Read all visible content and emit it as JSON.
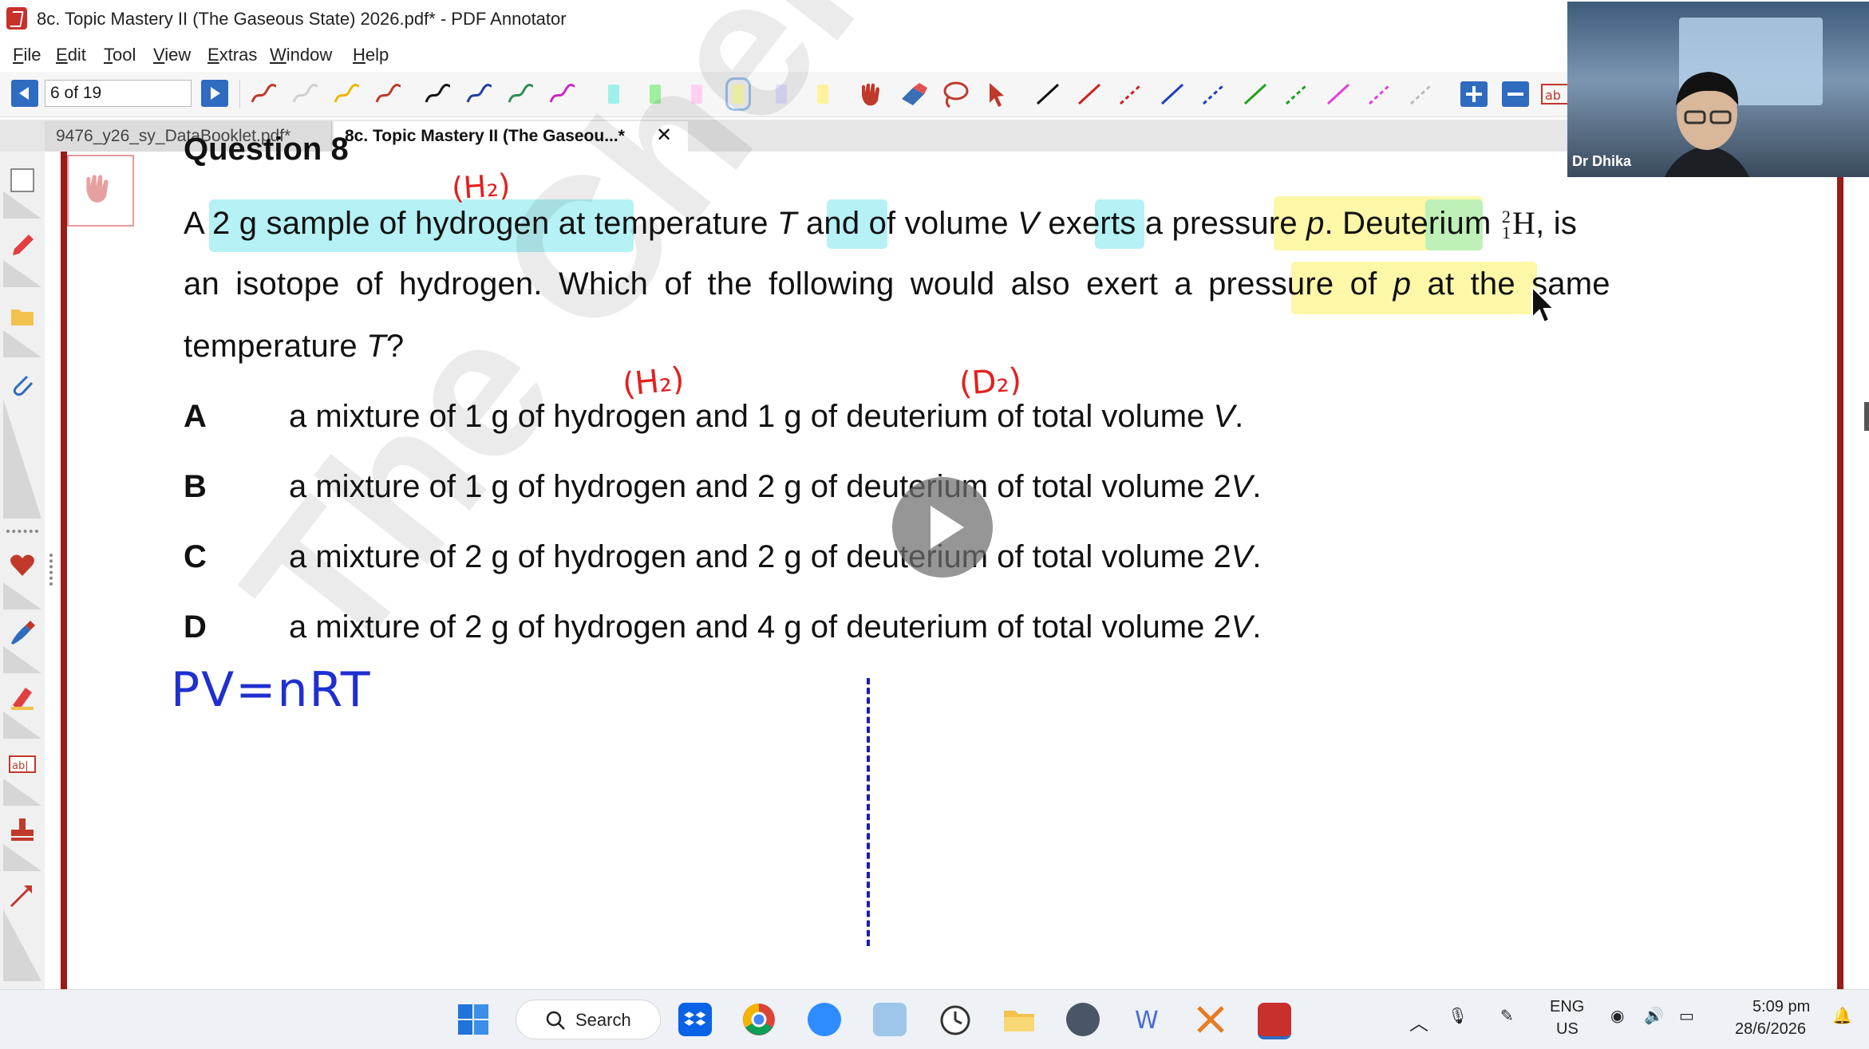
{
  "window": {
    "title": "8c. Topic Mastery II (The Gaseous State) 2026.pdf* - PDF Annotator"
  },
  "menu": {
    "items": [
      "File",
      "Edit",
      "Tool",
      "View",
      "Extras",
      "Window",
      "Help"
    ]
  },
  "toolbar": {
    "page_indicator": "6 of 19",
    "pen_colors": [
      "#c0392b",
      "#cfcfcf",
      "#f0b400",
      "#c0392b",
      "#111111",
      "#1e3fa0",
      "#2e8b57",
      "#d024c8"
    ],
    "highlighter_colors": [
      "#9ff0ea",
      "#9ef0a0",
      "#ffd0f0",
      "#ffffb0",
      "#e0e0ff",
      "#fff29a"
    ],
    "line_colors": [
      "#111111",
      "#d02020",
      "#d02020",
      "#1e3fc0",
      "#1e3fc0",
      "#20a020",
      "#20a020",
      "#e040e0",
      "#e040e0",
      "#bbbbbb"
    ],
    "text_tool": "ab"
  },
  "tabs": [
    {
      "label": "9476_y26_sy_DataBooklet.pdf*"
    },
    {
      "label": "8c. Topic Mastery II (The Gaseou...*"
    }
  ],
  "document": {
    "heading": "Question 8",
    "question": {
      "line1": [
        "A 2 g sample of hydrogen at temperature ",
        "T",
        " and of volume ",
        "V",
        " exerts a pressure ",
        "p",
        ". Deuterium "
      ],
      "isotope_super": "2",
      "isotope_sub": "1",
      "isotope_symbol": "H",
      "isotope_tail": ", is",
      "line2": [
        "an isotope of hydrogen. Which of the following would also exert a pressure of ",
        "p",
        " at the same"
      ],
      "line3": [
        "temperature ",
        "T",
        "?"
      ]
    },
    "options": [
      {
        "letter": "A",
        "text": "a mixture of 1 g of hydrogen and 1 g of deuterium of total volume ",
        "var": "V",
        "end": "."
      },
      {
        "letter": "B",
        "text": "a mixture of 1 g of hydrogen and 2 g of deuterium of total volume 2",
        "var": "V",
        "end": "."
      },
      {
        "letter": "C",
        "text": "a mixture of 2 g of hydrogen and 2 g of deuterium of total volume 2",
        "var": "V",
        "end": "."
      },
      {
        "letter": "D",
        "text": "a mixture of 2 g of hydrogen and 4 g of deuterium of total volume 2",
        "var": "V",
        "end": "."
      }
    ],
    "annotations": {
      "h2_top": "(H₂)",
      "h2_option": "(H₂)",
      "d2_option": "(D₂)",
      "formula": "PV=nRT"
    },
    "watermark": "The Chem"
  },
  "webcam": {
    "presenter_name": "Dr Dhika"
  },
  "taskbar": {
    "search_label": "Search",
    "language": "ENG",
    "region": "US",
    "time": "5:09 pm",
    "date": "28/6/2026"
  }
}
